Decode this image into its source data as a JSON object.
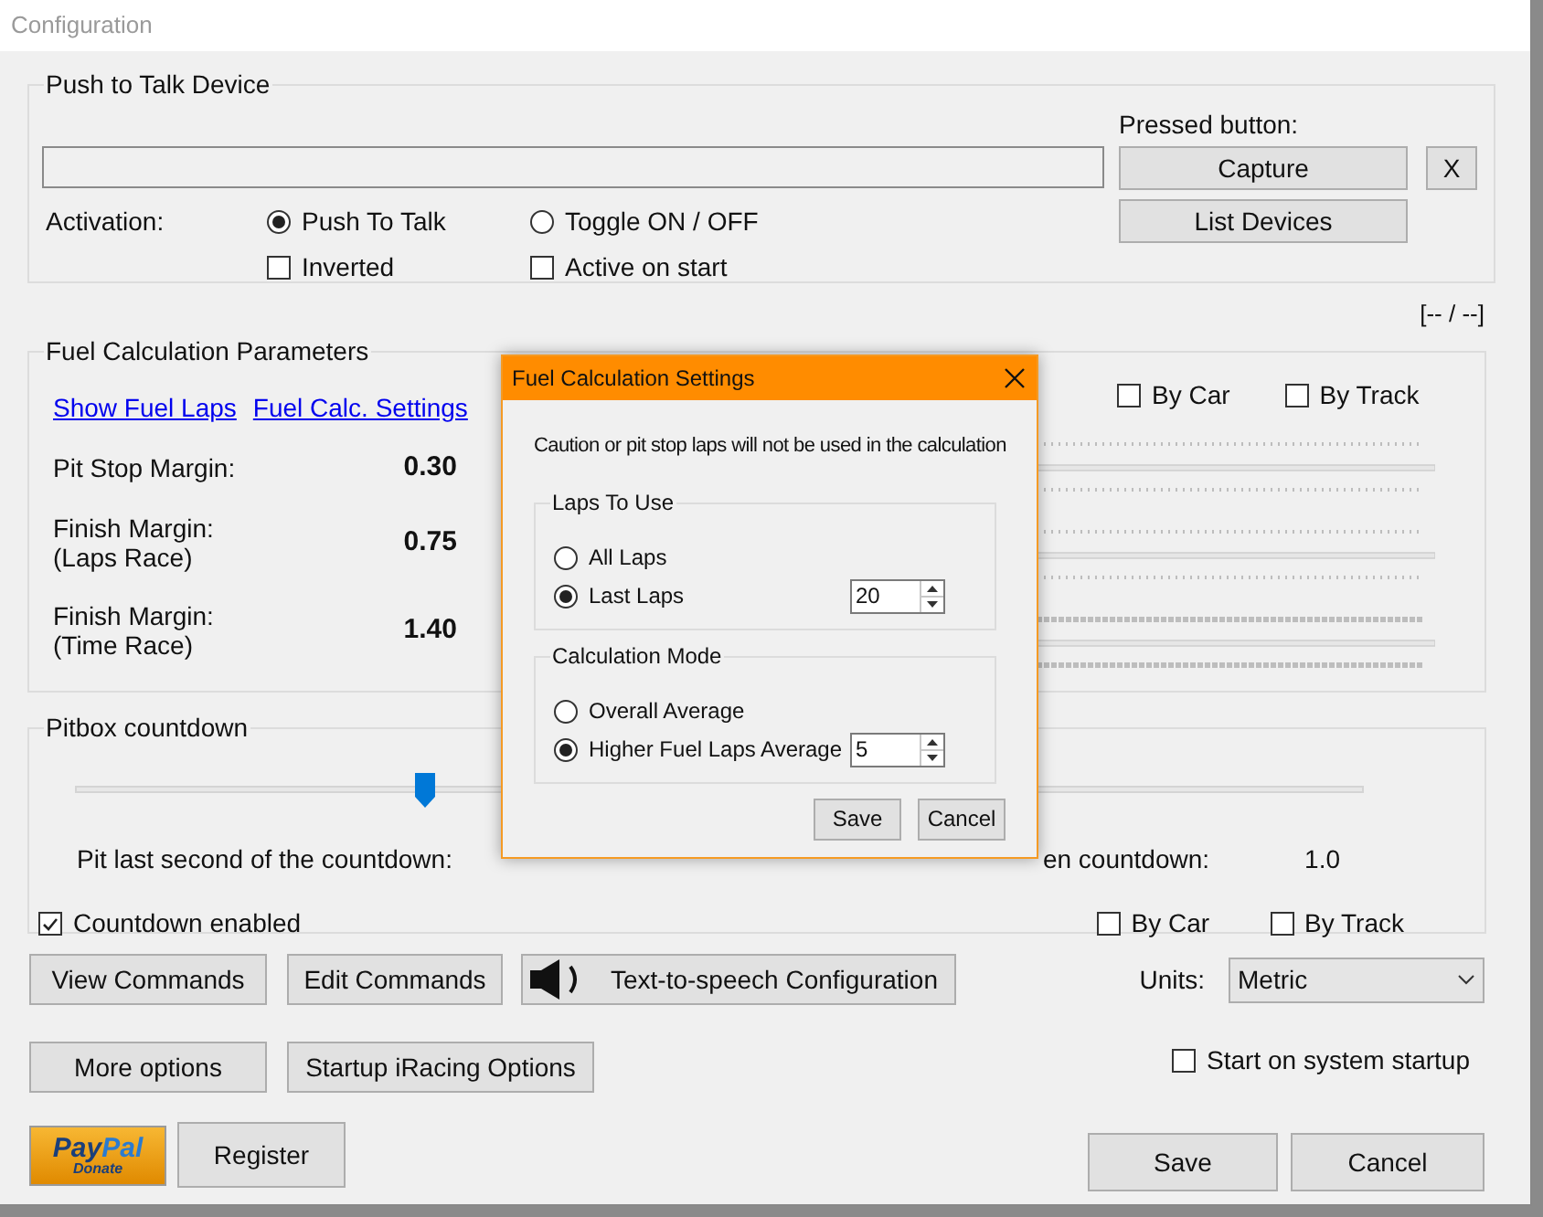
{
  "window": {
    "title": "Configuration"
  },
  "push_to_talk": {
    "title": "Push to Talk Device",
    "pressed_label": "Pressed button:",
    "capture": "Capture",
    "clear": "X",
    "list_devices": "List Devices",
    "activation_label": "Activation:",
    "modes": [
      {
        "label": "Push To Talk",
        "selected": true
      },
      {
        "label": "Toggle ON / OFF",
        "selected": false
      }
    ],
    "options": [
      {
        "label": "Inverted",
        "checked": false
      },
      {
        "label": "Active on start",
        "checked": false
      }
    ]
  },
  "counter": "[-- / --]",
  "fuel": {
    "title": "Fuel Calculation Parameters",
    "links": [
      "Show Fuel Laps",
      "Fuel Calc. Settings"
    ],
    "filters": [
      {
        "label": "By Car",
        "checked": false
      },
      {
        "label": "By Track",
        "checked": false
      }
    ],
    "margins": [
      {
        "lines": [
          "Pit Stop Margin:"
        ],
        "value": "0.30"
      },
      {
        "lines": [
          "Finish Margin:",
          "(Laps Race)"
        ],
        "value": "0.75"
      },
      {
        "lines": [
          "Finish Margin:",
          "(Time Race)"
        ],
        "value": "1.40"
      }
    ]
  },
  "pitbox": {
    "title": "Pitbox countdown",
    "slider": {
      "level": 0.27
    },
    "label": "Pit last second of the countdown:",
    "label_2": "en countdown:",
    "reading": "1.0",
    "countdown_enabled": {
      "label": "Countdown enabled",
      "checked": true
    },
    "filters": [
      {
        "label": "By Car",
        "checked": false
      },
      {
        "label": "By Track",
        "checked": false
      }
    ]
  },
  "buttons_row_1": [
    "View Commands",
    "Edit Commands",
    "Text-to-speech Configuration"
  ],
  "units": {
    "label": "Units:",
    "value": "Metric"
  },
  "buttons_row_2": [
    "More options",
    "Startup iRacing Options"
  ],
  "start_on_startup": {
    "label": "Start on system startup",
    "checked": false
  },
  "paypal": {
    "brand_1": "Pay",
    "brand_2": "Pal",
    "sub": "Donate"
  },
  "register": "Register",
  "footer_buttons": [
    "Save",
    "Cancel"
  ],
  "dialog": {
    "title": "Fuel Calculation Settings",
    "note": "Caution or pit stop laps will not be used in the calculation",
    "groups": [
      {
        "title": "Laps To Use",
        "options": [
          {
            "label": "All Laps",
            "selected": false
          },
          {
            "label": "Last Laps",
            "selected": true,
            "spin": "20"
          }
        ]
      },
      {
        "title": "Calculation Mode",
        "options": [
          {
            "label": "Overall Average",
            "selected": false
          },
          {
            "label": "Higher Fuel Laps Average",
            "selected": true,
            "spin": "5"
          }
        ]
      }
    ],
    "buttons": [
      "Save",
      "Cancel"
    ]
  }
}
